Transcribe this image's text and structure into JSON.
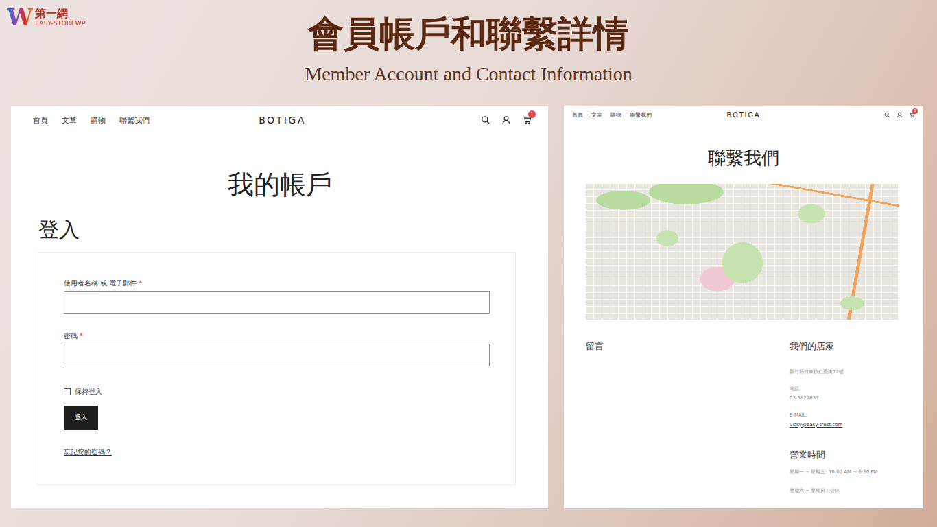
{
  "logo": {
    "mark": "W",
    "name": "第一網",
    "tagline": "EASY-STOREWP"
  },
  "title": "會員帳戶和聯繫詳情",
  "subtitle": "Member Account and Contact Information",
  "account_screen": {
    "nav": [
      "首頁",
      "文章",
      "購物",
      "聯繫我們"
    ],
    "site_name": "BOTIGA",
    "cart_count": "1",
    "page_title": "我的帳戶",
    "section_title": "登入",
    "fields": [
      {
        "label": "使用者名稱 或 電子郵件",
        "required_mark": "*"
      },
      {
        "label": "密碼",
        "required_mark": "*"
      }
    ],
    "remember": {
      "label": "保持登入",
      "checked": false
    },
    "submit": "登入",
    "forgot_link": "忘記您的密碼？"
  },
  "contact_screen": {
    "nav": [
      "首頁",
      "文章",
      "購物",
      "聯繫我們"
    ],
    "site_name": "BOTIGA",
    "cart_count": "1",
    "page_title": "聯繫我們",
    "message_heading": "留言",
    "store_heading": "我們的店家",
    "address": "新竹縣竹東鎮仁愛街12號",
    "phone_label": "電話:",
    "phone": "03-5827637",
    "email_label": "E-MAIL:",
    "email": "vicky@easy-trust.com",
    "hours_heading": "營業時間",
    "hours": [
      "星期一 ~ 星期五: 10:00 AM ~ 6:30 PM",
      "星期六 ~ 星期日：公休"
    ]
  }
}
